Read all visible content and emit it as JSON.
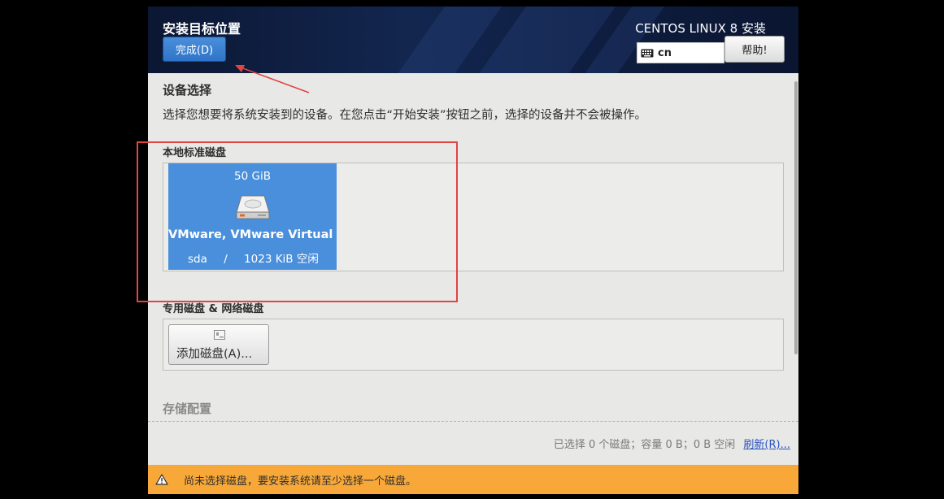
{
  "header": {
    "title": "安装目标位置",
    "done_button": "完成(D)",
    "product": "CENTOS LINUX 8 安装",
    "keyboard_layout": "cn",
    "help_button": "帮助!"
  },
  "device_selection": {
    "title": "设备选择",
    "description": "选择您想要将系统安装到的设备。在您点击“开始安装”按钮之前，选择的设备并不会被操作。"
  },
  "local_disks": {
    "heading": "本地标准磁盘",
    "disks": [
      {
        "size": "50 GiB",
        "name": "VMware, VMware Virtual S",
        "device": "sda",
        "separator": "/",
        "free": "1023 KiB 空闲"
      }
    ]
  },
  "specialized_disks": {
    "heading": "专用磁盘 & 网络磁盘",
    "add_button": "添加磁盘(A)..."
  },
  "storage_config": {
    "heading": "存储配置"
  },
  "summary": {
    "text": "已选择 0 个磁盘；容量 0 B；0 B 空闲",
    "refresh_link": "刷新(R)..."
  },
  "warning": {
    "text": "尚未选择磁盘，要安装系统请至少选择一个磁盘。"
  },
  "colors": {
    "accent": "#4a8fdb",
    "warning": "#f8a839",
    "annotation": "#e04444",
    "header_bg": "#0e1d40"
  }
}
